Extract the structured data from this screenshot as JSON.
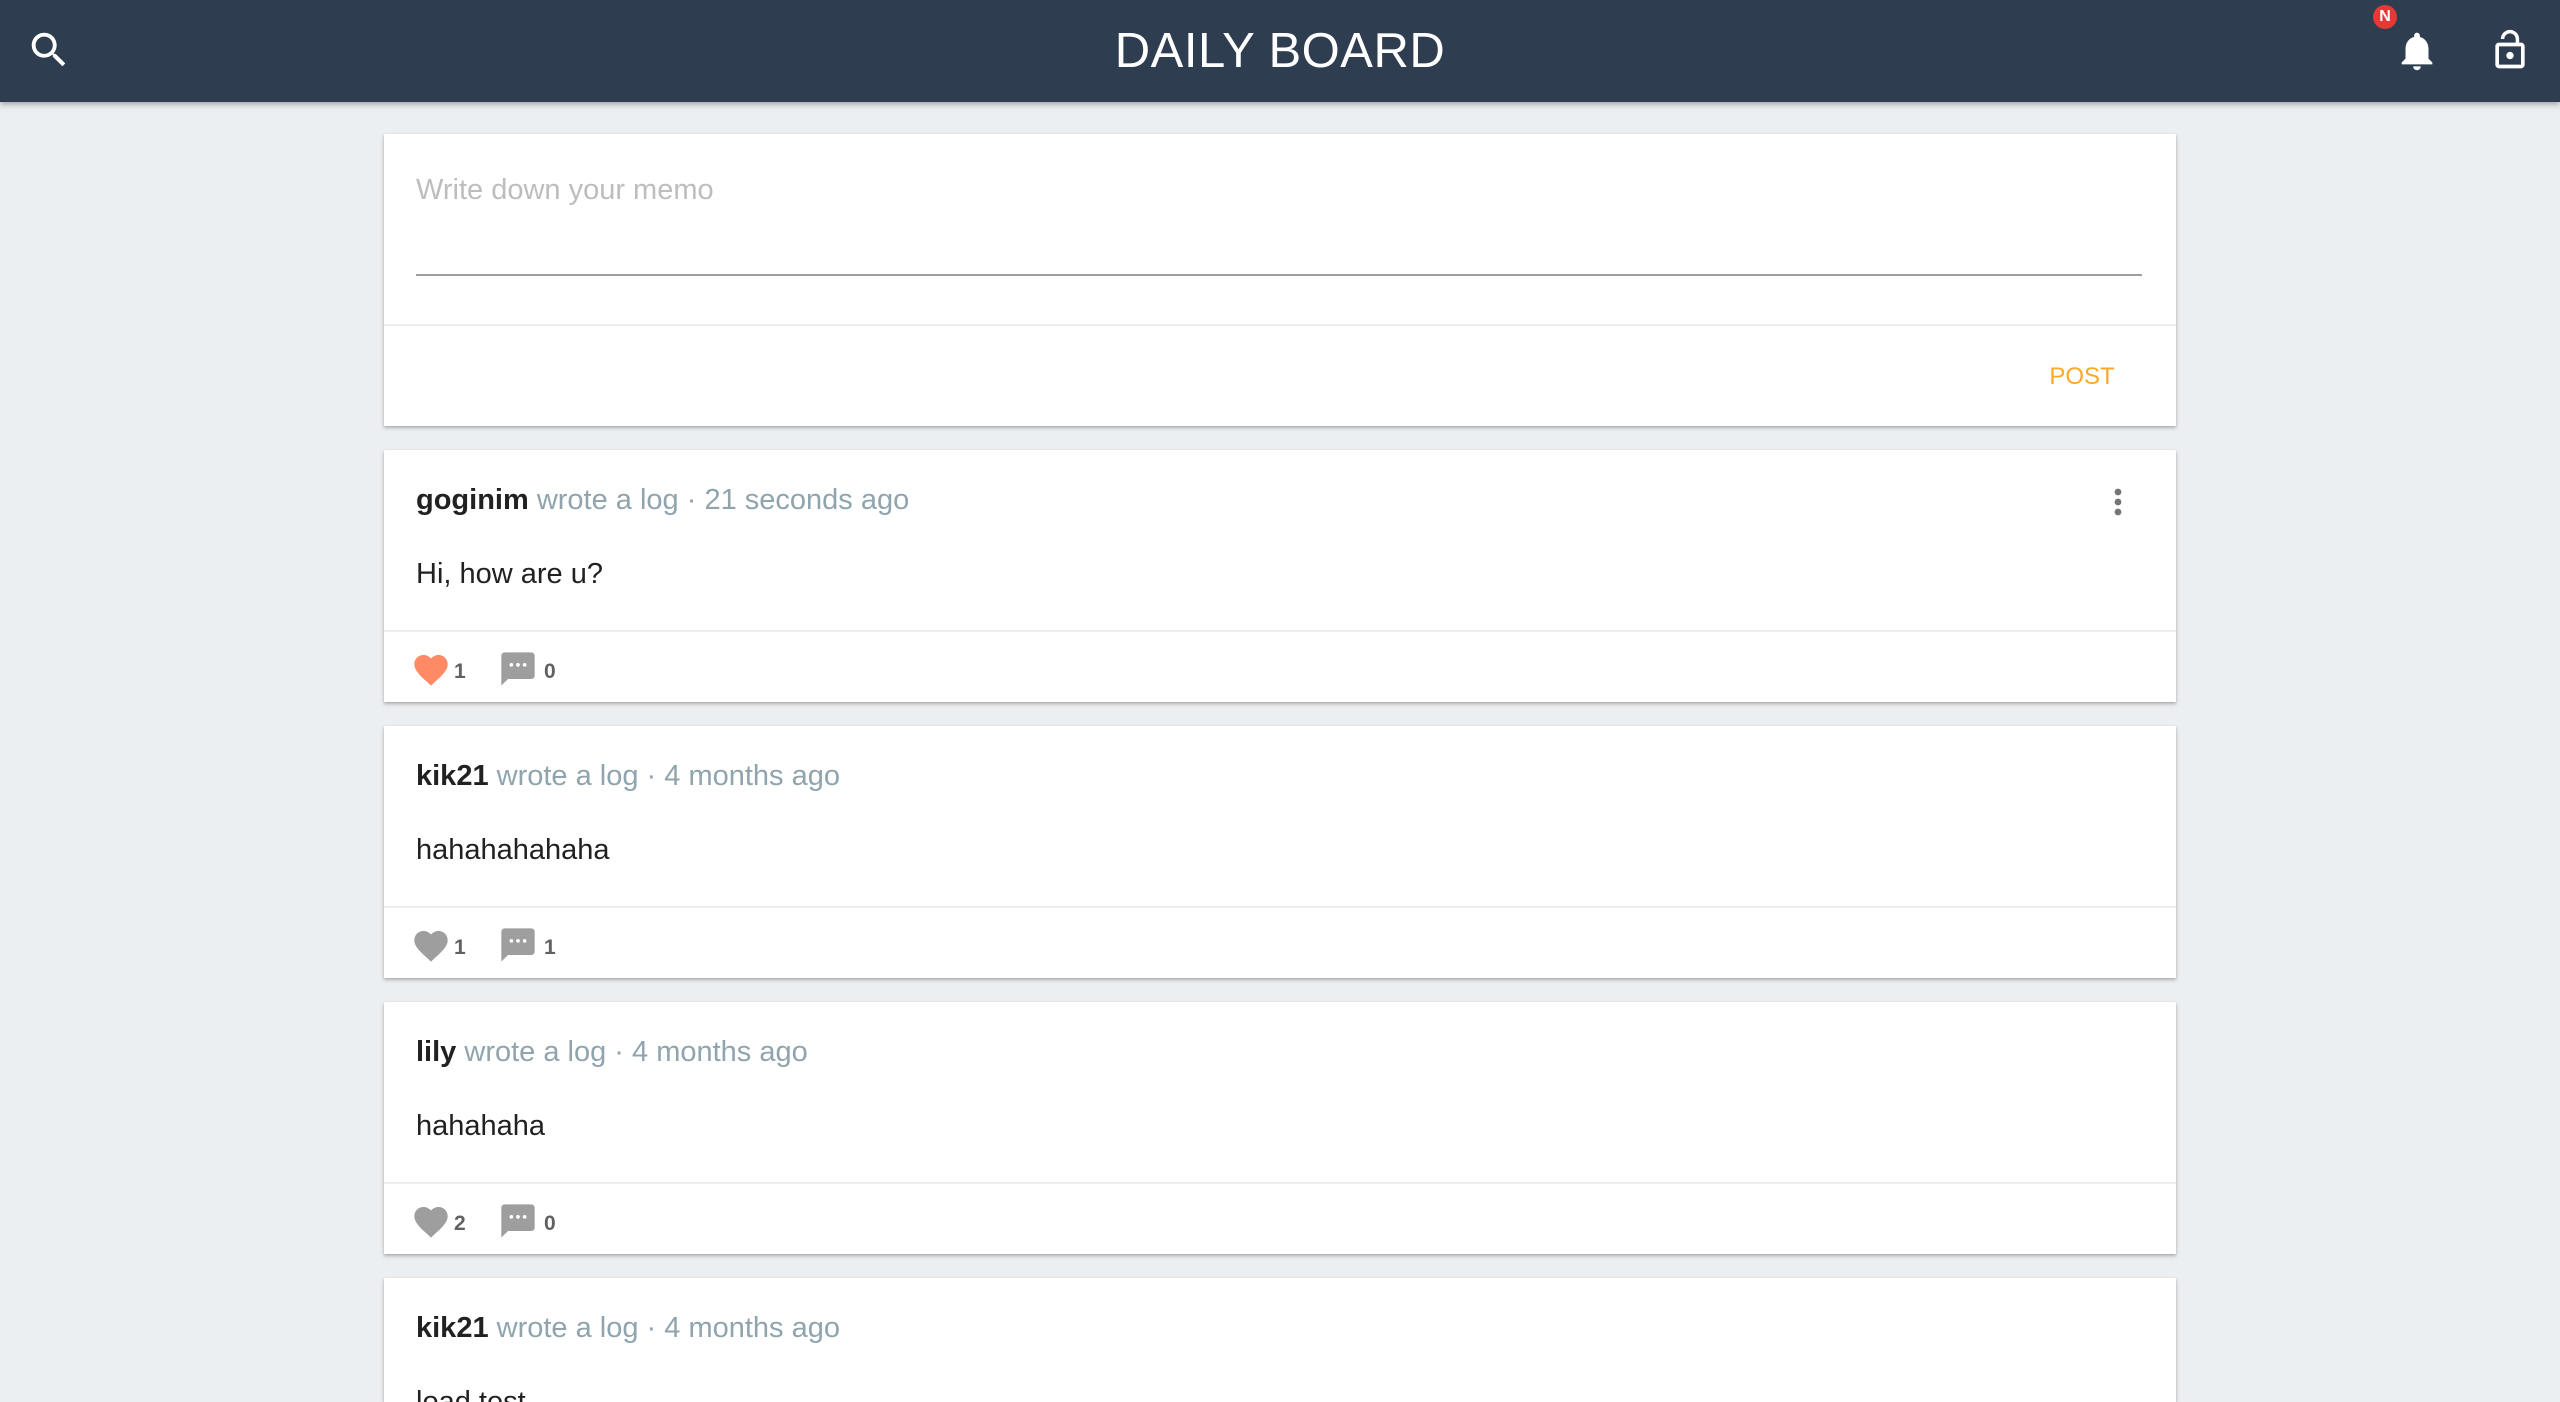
{
  "topbar": {
    "title": "DAILY BOARD",
    "notification_badge": "N",
    "icons": [
      "search-icon",
      "bell-icon",
      "lock-open-icon"
    ],
    "colors": {
      "background": "#2e3d4f",
      "badge": "#e53935"
    }
  },
  "write": {
    "placeholder": "Write down your memo",
    "post_label": "POST",
    "accent": "#ffa726"
  },
  "logs": [
    {
      "author": "goginim",
      "meta": "wrote a log · 21 seconds ago",
      "contents": "Hi, how are u?",
      "stars": "1",
      "starred": true,
      "comments": "0"
    },
    {
      "author": "kik21",
      "meta": "wrote a log · 4 months ago",
      "contents": "hahahahahaha",
      "stars": "1",
      "starred": false,
      "comments": "1"
    },
    {
      "author": "lily",
      "meta": "wrote a log · 4 months ago",
      "contents": "hahahaha",
      "stars": "2",
      "starred": false,
      "comments": "0"
    },
    {
      "author": "kik21",
      "meta": "wrote a log · 4 months ago",
      "contents": "load test",
      "stars": "",
      "starred": false,
      "comments": ""
    }
  ],
  "colors": {
    "starred": "#ff8a65",
    "unstarred": "#9e9e9e",
    "meta": "#90a4ae"
  }
}
